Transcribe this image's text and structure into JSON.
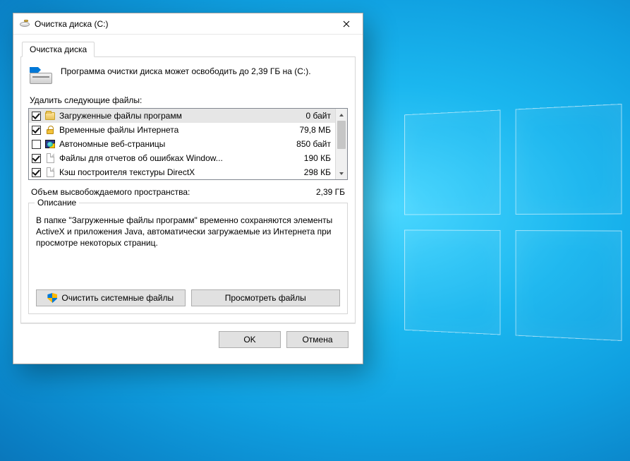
{
  "window": {
    "title": "Очистка диска  (C:)"
  },
  "tab": {
    "label": "Очистка диска"
  },
  "summary": "Программа очистки диска может освободить до 2,39 ГБ на (C:).",
  "list_label": "Удалить следующие файлы:",
  "items": [
    {
      "checked": true,
      "icon": "folder",
      "name": "Загруженные файлы программ",
      "size": "0 байт",
      "selected": true
    },
    {
      "checked": true,
      "icon": "lock",
      "name": "Временные файлы Интернета",
      "size": "79,8 МБ"
    },
    {
      "checked": false,
      "icon": "web",
      "name": "Автономные веб-страницы",
      "size": "850 байт"
    },
    {
      "checked": true,
      "icon": "doc",
      "name": "Файлы для отчетов об ошибках Window...",
      "size": "190 КБ"
    },
    {
      "checked": true,
      "icon": "doc",
      "name": "Кэш построителя текстуры DirectX",
      "size": "298 КБ"
    }
  ],
  "total": {
    "label": "Объем высвобождаемого пространства:",
    "value": "2,39 ГБ"
  },
  "group": {
    "legend": "Описание",
    "description": "В папке \"Загруженные файлы программ\" временно сохраняются элементы ActiveX и приложения Java, автоматически загружаемые из Интернета при просмотре некоторых страниц.",
    "clean_system": "Очистить системные файлы",
    "view_files": "Просмотреть файлы"
  },
  "footer": {
    "ok": "OK",
    "cancel": "Отмена"
  }
}
